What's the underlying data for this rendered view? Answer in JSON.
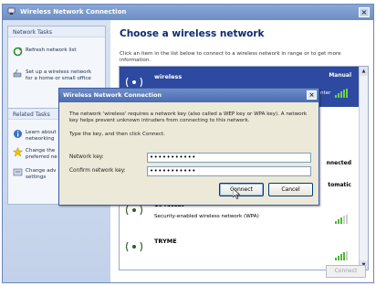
{
  "window": {
    "title": "Wireless Network Connection",
    "close": "×"
  },
  "left": {
    "network_tasks": {
      "header": "Network Tasks",
      "items": [
        "Refresh network list",
        "Set up a wireless network",
        "for a home or small office"
      ]
    },
    "related_tasks": {
      "header": "Related Tasks",
      "items": [
        [
          "Learn about",
          "networking"
        ],
        [
          "Change the",
          "preferred ne"
        ],
        [
          "Change adv",
          "settings"
        ]
      ]
    }
  },
  "main": {
    "heading": "Choose a wireless network",
    "instructions": "Click an item in the list below to connect to a wireless network in range or to get more information.",
    "networks": [
      {
        "name": "wireless",
        "status": "Manual",
        "security": "",
        "extra": "nter"
      },
      {
        "name": "",
        "status": "nnected",
        "security": ""
      },
      {
        "name": "",
        "status": "tomatic",
        "security": ""
      },
      {
        "name": "1046test",
        "status": "",
        "security": "Security-enabled wireless network (WPA)"
      },
      {
        "name": "TRYME",
        "status": "",
        "security": ""
      }
    ],
    "connect_button": "Connect"
  },
  "dialog": {
    "title": "Wireless Network Connection",
    "close": "×",
    "message": "The network 'wireless' requires a network key (also called a WEP key or WPA key). A network key helps prevent unknown intruders from connecting to this network.",
    "prompt": "Type the key, and then click Connect.",
    "key_label": "Network key:",
    "key_value": "•••••••••••",
    "confirm_label": "Confirm network key:",
    "confirm_value": "•••••••••••",
    "connect_button": "Connect",
    "cancel_button": "Cancel"
  },
  "colors": {
    "selection": "#2d4aa0",
    "title_bar": "#6e8ec4",
    "dialog_bg": "#ece9d8",
    "heading": "#0b2a6f"
  }
}
